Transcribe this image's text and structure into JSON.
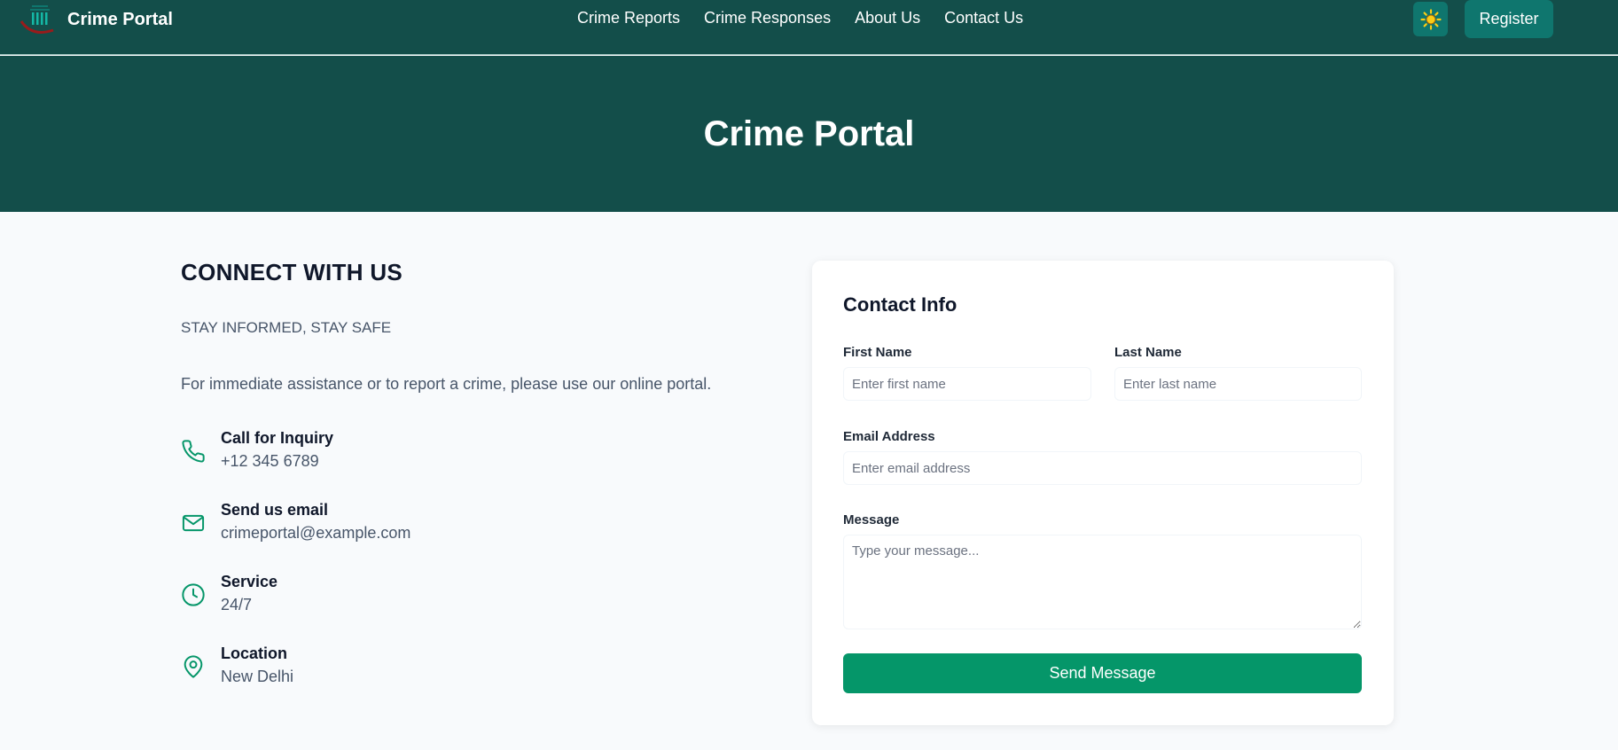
{
  "brand": {
    "name": "Crime Portal",
    "logo_icon": "crime-portal-logo"
  },
  "nav": {
    "links": [
      {
        "label": "Crime Reports"
      },
      {
        "label": "Crime Responses"
      },
      {
        "label": "About Us"
      },
      {
        "label": "Contact Us"
      }
    ],
    "theme_toggle_icon": "sun-icon",
    "register_label": "Register"
  },
  "hero": {
    "title": "Crime Portal"
  },
  "connect": {
    "title": "CONNECT WITH US",
    "tagline": "STAY INFORMED, STAY SAFE",
    "description": "For immediate assistance or to report a crime, please use our online portal.",
    "items": [
      {
        "icon": "phone-icon",
        "label": "Call for Inquiry",
        "value": "+12 345 6789"
      },
      {
        "icon": "mail-icon",
        "label": "Send us email",
        "value": "crimeportal@example.com"
      },
      {
        "icon": "clock-icon",
        "label": "Service",
        "value": "24/7"
      },
      {
        "icon": "map-pin-icon",
        "label": "Location",
        "value": "New Delhi"
      }
    ]
  },
  "form": {
    "title": "Contact Info",
    "first_name": {
      "label": "First Name",
      "placeholder": "Enter first name",
      "value": ""
    },
    "last_name": {
      "label": "Last Name",
      "placeholder": "Enter last name",
      "value": ""
    },
    "email": {
      "label": "Email Address",
      "placeholder": "Enter email address",
      "value": ""
    },
    "message": {
      "label": "Message",
      "placeholder": "Type your message...",
      "value": ""
    },
    "submit_label": "Send Message"
  },
  "colors": {
    "header_bg": "#134e4a",
    "button_teal": "#0f766e",
    "accent_green": "#059669",
    "sun_yellow": "#facc15",
    "page_bg": "#f8fafc"
  }
}
